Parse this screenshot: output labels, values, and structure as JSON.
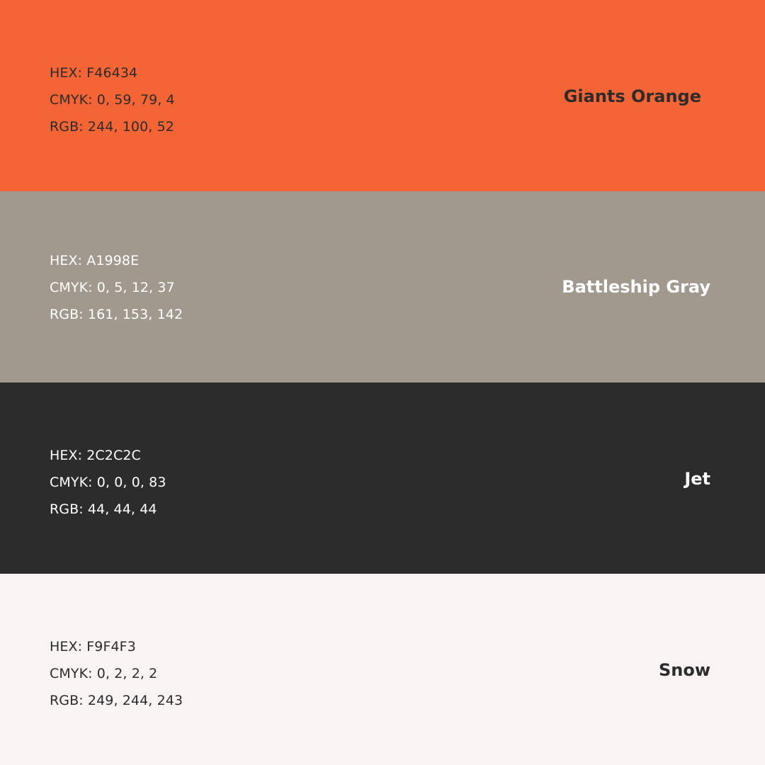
{
  "swatches": [
    {
      "name": "Giants Orange",
      "hex_line": "HEX: F46434",
      "cmyk_line": "CMYK: 0, 59, 79, 4",
      "rgb_line": "RGB: 244, 100, 52",
      "background": "#F46434",
      "text_color": "#2C2C2C"
    },
    {
      "name": "Battleship Gray",
      "hex_line": "HEX: A1998E",
      "cmyk_line": "CMYK: 0, 5, 12, 37",
      "rgb_line": "RGB: 161, 153, 142",
      "background": "#A1998E",
      "text_color": "#FFFFFF"
    },
    {
      "name": "Jet",
      "hex_line": "HEX: 2C2C2C",
      "cmyk_line": "CMYK: 0, 0, 0, 83",
      "rgb_line": "RGB: 44, 44, 44",
      "background": "#2C2C2C",
      "text_color": "#FFFFFF"
    },
    {
      "name": "Snow",
      "hex_line": "HEX: F9F4F3",
      "cmyk_line": "CMYK: 0, 2, 2, 2",
      "rgb_line": "RGB: 249, 244, 243",
      "background": "#F9F4F3",
      "text_color": "#2C2C2C"
    }
  ]
}
